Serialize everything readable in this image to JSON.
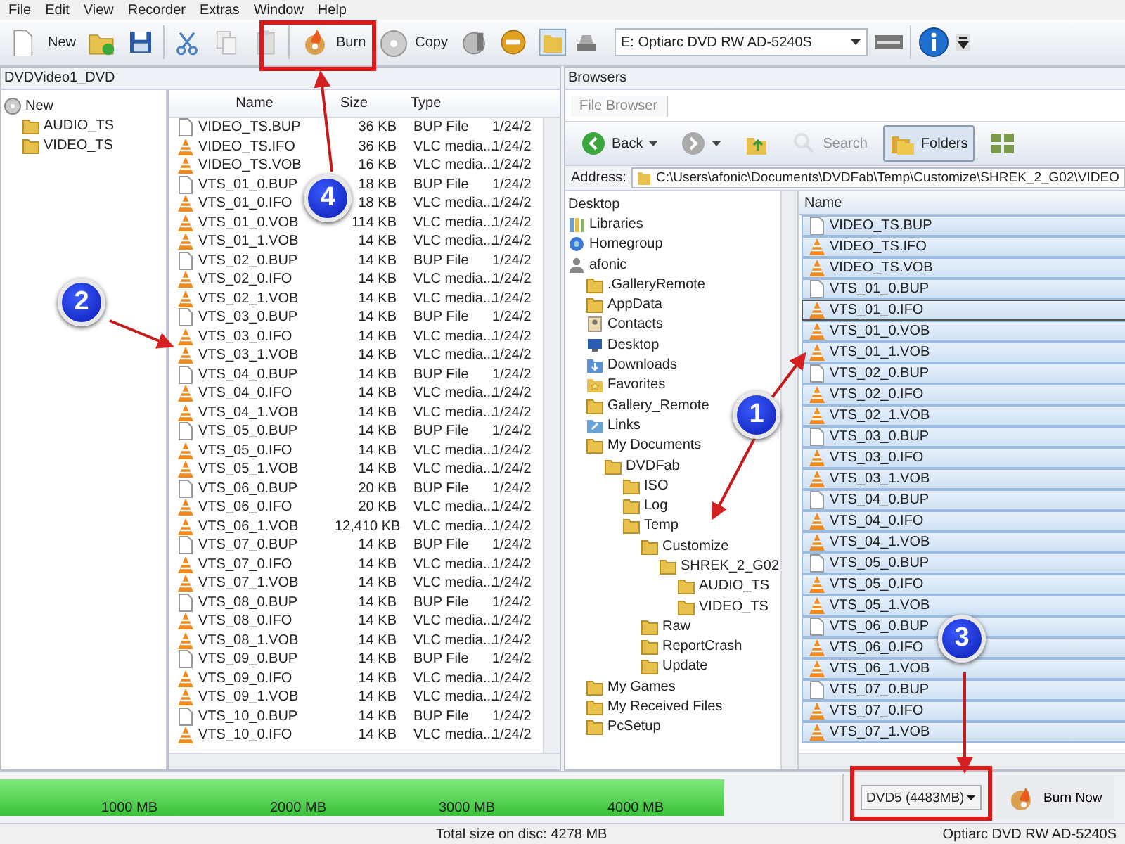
{
  "menu": [
    "File",
    "Edit",
    "View",
    "Recorder",
    "Extras",
    "Window",
    "Help"
  ],
  "toolbar": [
    {
      "kind": "page"
    },
    {
      "kind": "text",
      "label": "New"
    },
    {
      "kind": "folder-add"
    },
    {
      "kind": "save"
    },
    {
      "kind": "sep"
    },
    {
      "kind": "scissors"
    },
    {
      "kind": "copy"
    },
    {
      "kind": "paste"
    },
    {
      "kind": "sep"
    },
    {
      "kind": "burn",
      "label": "Burn"
    },
    {
      "kind": "disc",
      "label": "Copy"
    },
    {
      "kind": "disc2"
    },
    {
      "kind": "erase"
    },
    {
      "kind": "folder-page"
    }
  ],
  "drive": {
    "value": "E: Optiarc DVD RW AD-5240S"
  },
  "left_panel": {
    "title": "DVDVideo1_DVD",
    "tree": [
      {
        "label": "New",
        "kind": "disc",
        "children": [
          {
            "label": "AUDIO_TS",
            "kind": "folder"
          },
          {
            "label": "VIDEO_TS",
            "kind": "folder"
          }
        ]
      }
    ],
    "file_list": {
      "columns": [
        "Name",
        "Size",
        "Type"
      ],
      "rows": [
        {
          "name": "VIDEO_TS.BUP",
          "size": "36 KB",
          "type": "BUP File",
          "date": "1/24/2",
          "kind": "doc"
        },
        {
          "name": "VIDEO_TS.IFO",
          "size": "36 KB",
          "type": "VLC media...",
          "date": "1/24/2",
          "kind": "media"
        },
        {
          "name": "VIDEO_TS.VOB",
          "size": "16 KB",
          "type": "VLC media...",
          "date": "1/24/2",
          "kind": "media"
        },
        {
          "name": "VTS_01_0.BUP",
          "size": "18 KB",
          "type": "BUP File",
          "date": "1/24/2",
          "kind": "doc"
        },
        {
          "name": "VTS_01_0.IFO",
          "size": "18 KB",
          "type": "VLC media...",
          "date": "1/24/2",
          "kind": "media"
        },
        {
          "name": "VTS_01_0.VOB",
          "size": "114 KB",
          "type": "VLC media...",
          "date": "1/24/2",
          "kind": "media"
        },
        {
          "name": "VTS_01_1.VOB",
          "size": "14 KB",
          "type": "VLC media...",
          "date": "1/24/2",
          "kind": "media"
        },
        {
          "name": "VTS_02_0.BUP",
          "size": "14 KB",
          "type": "BUP File",
          "date": "1/24/2",
          "kind": "doc"
        },
        {
          "name": "VTS_02_0.IFO",
          "size": "14 KB",
          "type": "VLC media...",
          "date": "1/24/2",
          "kind": "media"
        },
        {
          "name": "VTS_02_1.VOB",
          "size": "14 KB",
          "type": "VLC media...",
          "date": "1/24/2",
          "kind": "media"
        },
        {
          "name": "VTS_03_0.BUP",
          "size": "14 KB",
          "type": "BUP File",
          "date": "1/24/2",
          "kind": "doc"
        },
        {
          "name": "VTS_03_0.IFO",
          "size": "14 KB",
          "type": "VLC media...",
          "date": "1/24/2",
          "kind": "media"
        },
        {
          "name": "VTS_03_1.VOB",
          "size": "14 KB",
          "type": "VLC media...",
          "date": "1/24/2",
          "kind": "media"
        },
        {
          "name": "VTS_04_0.BUP",
          "size": "14 KB",
          "type": "BUP File",
          "date": "1/24/2",
          "kind": "doc"
        },
        {
          "name": "VTS_04_0.IFO",
          "size": "14 KB",
          "type": "VLC media...",
          "date": "1/24/2",
          "kind": "media"
        },
        {
          "name": "VTS_04_1.VOB",
          "size": "14 KB",
          "type": "VLC media...",
          "date": "1/24/2",
          "kind": "media"
        },
        {
          "name": "VTS_05_0.BUP",
          "size": "14 KB",
          "type": "BUP File",
          "date": "1/24/2",
          "kind": "doc"
        },
        {
          "name": "VTS_05_0.IFO",
          "size": "14 KB",
          "type": "VLC media...",
          "date": "1/24/2",
          "kind": "media"
        },
        {
          "name": "VTS_05_1.VOB",
          "size": "14 KB",
          "type": "VLC media...",
          "date": "1/24/2",
          "kind": "media"
        },
        {
          "name": "VTS_06_0.BUP",
          "size": "20 KB",
          "type": "BUP File",
          "date": "1/24/2",
          "kind": "doc"
        },
        {
          "name": "VTS_06_0.IFO",
          "size": "20 KB",
          "type": "VLC media...",
          "date": "1/24/2",
          "kind": "media"
        },
        {
          "name": "VTS_06_1.VOB",
          "size": "12,410 KB",
          "type": "VLC media...",
          "date": "1/24/2",
          "kind": "media"
        },
        {
          "name": "VTS_07_0.BUP",
          "size": "14 KB",
          "type": "BUP File",
          "date": "1/24/2",
          "kind": "doc"
        },
        {
          "name": "VTS_07_0.IFO",
          "size": "14 KB",
          "type": "VLC media...",
          "date": "1/24/2",
          "kind": "media"
        },
        {
          "name": "VTS_07_1.VOB",
          "size": "14 KB",
          "type": "VLC media...",
          "date": "1/24/2",
          "kind": "media"
        },
        {
          "name": "VTS_08_0.BUP",
          "size": "14 KB",
          "type": "BUP File",
          "date": "1/24/2",
          "kind": "doc"
        },
        {
          "name": "VTS_08_0.IFO",
          "size": "14 KB",
          "type": "VLC media...",
          "date": "1/24/2",
          "kind": "media"
        },
        {
          "name": "VTS_08_1.VOB",
          "size": "14 KB",
          "type": "VLC media...",
          "date": "1/24/2",
          "kind": "media"
        },
        {
          "name": "VTS_09_0.BUP",
          "size": "14 KB",
          "type": "BUP File",
          "date": "1/24/2",
          "kind": "doc"
        },
        {
          "name": "VTS_09_0.IFO",
          "size": "14 KB",
          "type": "VLC media...",
          "date": "1/24/2",
          "kind": "media"
        },
        {
          "name": "VTS_09_1.VOB",
          "size": "14 KB",
          "type": "VLC media...",
          "date": "1/24/2",
          "kind": "media"
        },
        {
          "name": "VTS_10_0.BUP",
          "size": "14 KB",
          "type": "BUP File",
          "date": "1/24/2",
          "kind": "doc"
        },
        {
          "name": "VTS_10_0.IFO",
          "size": "14 KB",
          "type": "VLC media...",
          "date": "1/24/2",
          "kind": "media"
        }
      ]
    }
  },
  "browser": {
    "title": "Browsers",
    "tabs": [
      {
        "label": "File Browser",
        "selected": true
      }
    ],
    "nav": [
      {
        "label": "Back",
        "kind": "back",
        "disabled": false,
        "selected": false
      },
      {
        "kind": "forward",
        "disabled": false,
        "selected": false
      },
      {
        "kind": "up",
        "disabled": false,
        "selected": false
      },
      {
        "label": "Search",
        "kind": "search",
        "disabled": true,
        "selected": false
      },
      {
        "label": "Folders",
        "kind": "folders",
        "disabled": false,
        "selected": true
      },
      {
        "kind": "views",
        "disabled": false,
        "selected": false
      }
    ],
    "address": {
      "label": "Address:",
      "value": "C:\\Users\\afonic\\Documents\\DVDFab\\Temp\\Customize\\SHREK_2_G02\\VIDEO"
    },
    "tree": [
      {
        "label": "Desktop",
        "kind": "plain"
      },
      {
        "label": "Libraries",
        "kind": "library"
      },
      {
        "label": "Homegroup",
        "kind": "homegroup"
      },
      {
        "label": "afonic",
        "kind": "user",
        "children": [
          {
            "label": ".GalleryRemote",
            "kind": "folder"
          },
          {
            "label": "AppData",
            "kind": "folder"
          },
          {
            "label": "Contacts",
            "kind": "contacts"
          },
          {
            "label": "Desktop",
            "kind": "desktop"
          },
          {
            "label": "Downloads",
            "kind": "downloads"
          },
          {
            "label": "Favorites",
            "kind": "favorites"
          },
          {
            "label": "Gallery_Remote",
            "kind": "folder"
          },
          {
            "label": "Links",
            "kind": "links"
          },
          {
            "label": "My Documents",
            "kind": "folder",
            "children": [
              {
                "label": "DVDFab",
                "kind": "folder",
                "children": [
                  {
                    "label": "ISO",
                    "kind": "folder"
                  },
                  {
                    "label": "Log",
                    "kind": "folder"
                  },
                  {
                    "label": "Temp",
                    "kind": "folder",
                    "children": [
                      {
                        "label": "Customize",
                        "kind": "folder",
                        "children": [
                          {
                            "label": "SHREK_2_G02",
                            "kind": "folder",
                            "children": [
                              {
                                "label": "AUDIO_TS",
                                "kind": "folder"
                              },
                              {
                                "label": "VIDEO_TS",
                                "kind": "folder"
                              }
                            ]
                          }
                        ]
                      },
                      {
                        "label": "Raw",
                        "kind": "folder"
                      },
                      {
                        "label": "ReportCrash",
                        "kind": "folder"
                      },
                      {
                        "label": "Update",
                        "kind": "folder"
                      }
                    ]
                  }
                ]
              }
            ]
          },
          {
            "label": "My Games",
            "kind": "folder"
          },
          {
            "label": "My Received Files",
            "kind": "folder"
          },
          {
            "label": "PcSetup",
            "kind": "folder"
          }
        ]
      }
    ],
    "file_list": {
      "columns": [
        "Name"
      ],
      "rows": [
        {
          "name": "VIDEO_TS.BUP",
          "kind": "doc",
          "selected": true,
          "focused": false
        },
        {
          "name": "VIDEO_TS.IFO",
          "kind": "media",
          "selected": true,
          "focused": false
        },
        {
          "name": "VIDEO_TS.VOB",
          "kind": "media",
          "selected": true,
          "focused": false
        },
        {
          "name": "VTS_01_0.BUP",
          "kind": "doc",
          "selected": true,
          "focused": false
        },
        {
          "name": "VTS_01_0.IFO",
          "kind": "media",
          "selected": true,
          "focused": true
        },
        {
          "name": "VTS_01_0.VOB",
          "kind": "media",
          "selected": true,
          "focused": false
        },
        {
          "name": "VTS_01_1.VOB",
          "kind": "media",
          "selected": true,
          "focused": false
        },
        {
          "name": "VTS_02_0.BUP",
          "kind": "doc",
          "selected": true,
          "focused": false
        },
        {
          "name": "VTS_02_0.IFO",
          "kind": "media",
          "selected": true,
          "focused": false
        },
        {
          "name": "VTS_02_1.VOB",
          "kind": "media",
          "selected": true,
          "focused": false
        },
        {
          "name": "VTS_03_0.BUP",
          "kind": "doc",
          "selected": true,
          "focused": false
        },
        {
          "name": "VTS_03_0.IFO",
          "kind": "media",
          "selected": true,
          "focused": false
        },
        {
          "name": "VTS_03_1.VOB",
          "kind": "media",
          "selected": true,
          "focused": false
        },
        {
          "name": "VTS_04_0.BUP",
          "kind": "doc",
          "selected": true,
          "focused": false
        },
        {
          "name": "VTS_04_0.IFO",
          "kind": "media",
          "selected": true,
          "focused": false
        },
        {
          "name": "VTS_04_1.VOB",
          "kind": "media",
          "selected": true,
          "focused": false
        },
        {
          "name": "VTS_05_0.BUP",
          "kind": "doc",
          "selected": true,
          "focused": false
        },
        {
          "name": "VTS_05_0.IFO",
          "kind": "media",
          "selected": true,
          "focused": false
        },
        {
          "name": "VTS_05_1.VOB",
          "kind": "media",
          "selected": true,
          "focused": false
        },
        {
          "name": "VTS_06_0.BUP",
          "kind": "doc",
          "selected": true,
          "focused": false
        },
        {
          "name": "VTS_06_0.IFO",
          "kind": "media",
          "selected": true,
          "focused": false
        },
        {
          "name": "VTS_06_1.VOB",
          "kind": "media",
          "selected": true,
          "focused": false
        },
        {
          "name": "VTS_07_0.BUP",
          "kind": "doc",
          "selected": true,
          "focused": false
        },
        {
          "name": "VTS_07_0.IFO",
          "kind": "media",
          "selected": true,
          "focused": false
        },
        {
          "name": "VTS_07_1.VOB",
          "kind": "media",
          "selected": true,
          "focused": false
        }
      ]
    }
  },
  "capacity": {
    "level": 0.86,
    "labels": [
      "1000 MB",
      "2000 MB",
      "3000 MB",
      "4000 MB"
    ]
  },
  "disc_type": {
    "value": "DVD5 (4483MB)"
  },
  "burn_now": {
    "label": "Burn Now"
  },
  "status_bar": {
    "total": "Total size on disc: 4278 MB",
    "drive": "Optiarc  DVD RW AD-5240S"
  },
  "annotations": [
    {
      "number": "1"
    },
    {
      "number": "2"
    },
    {
      "number": "3"
    },
    {
      "number": "4"
    }
  ]
}
